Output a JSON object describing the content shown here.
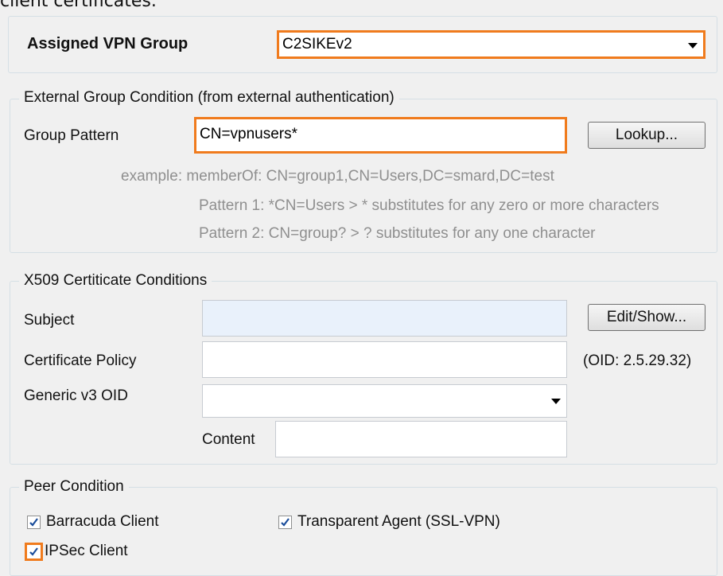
{
  "top_text": "client certificates.",
  "assigned_vpn": {
    "label": "Assigned VPN Group",
    "value": "C2SIKEv2"
  },
  "external_group": {
    "legend": "External Group Condition (from external authentication)",
    "pattern_label": "Group Pattern",
    "pattern_value": "CN=vpnusers*",
    "lookup_button": "Lookup...",
    "example_line": "example:  memberOf: CN=group1,CN=Users,DC=smard,DC=test",
    "pattern1": "Pattern 1: *CN=Users   > * substitutes for any zero or more characters",
    "pattern2": "Pattern 2: CN=group?  > ? substitutes for any one character"
  },
  "x509": {
    "legend": "X509 Certiticate Conditions",
    "subject_label": "Subject",
    "subject_value": "",
    "edit_button": "Edit/Show...",
    "policy_label": "Certificate Policy",
    "policy_value": "",
    "oid_text": "(OID: 2.5.29.32)",
    "generic_label": "Generic v3 OID",
    "generic_value": "",
    "content_label": "Content",
    "content_value": ""
  },
  "peer": {
    "legend": "Peer Condition",
    "barracuda_client": {
      "label": "Barracuda Client",
      "checked": true
    },
    "transparent_agent": {
      "label": "Transparent Agent (SSL-VPN)",
      "checked": true
    },
    "ipsec_client": {
      "label": "IPSec Client",
      "checked": true
    }
  },
  "colors": {
    "highlight": "#f07b1d",
    "hint_text": "#8f8f8f",
    "subject_field_bg": "#e9f1fb"
  }
}
